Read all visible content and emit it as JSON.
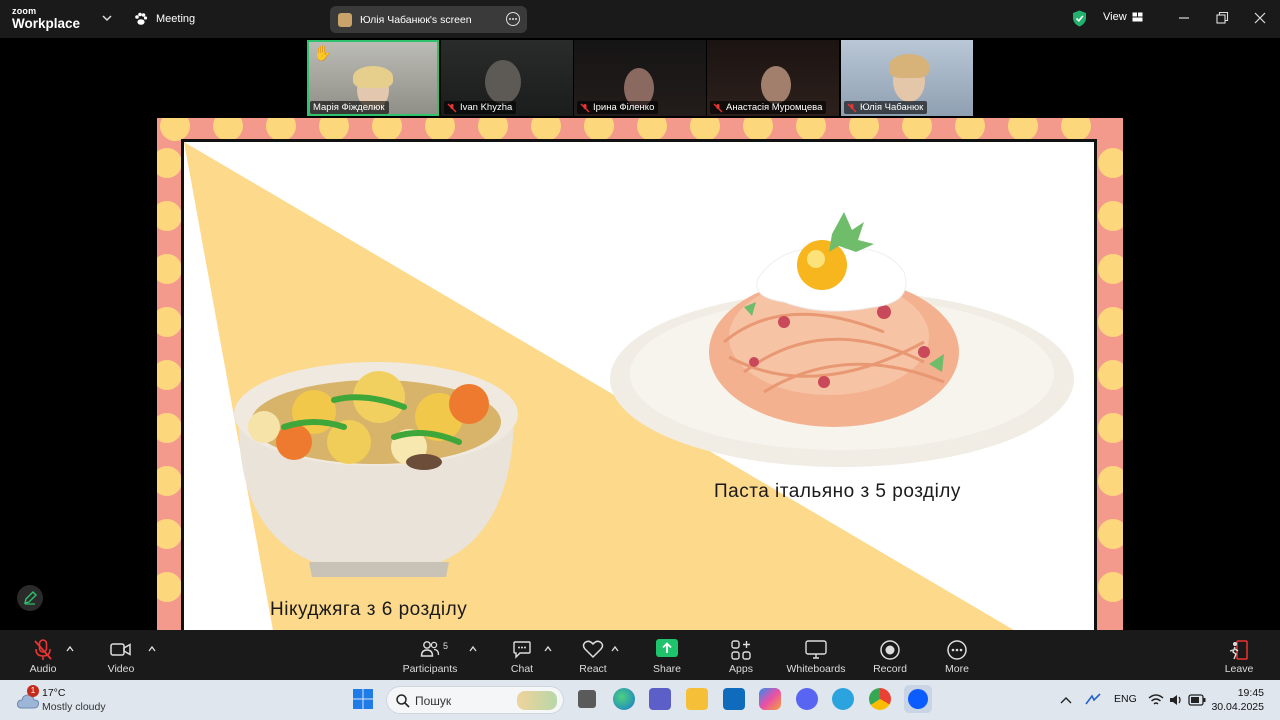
{
  "app": {
    "logo_line1": "zoom",
    "logo_line2": "Workplace",
    "meeting_label": "Meeting"
  },
  "share_indicator": {
    "label": "Юлія Чабанюк's screen"
  },
  "header": {
    "view_label": "View"
  },
  "participants": [
    {
      "name": "Марія Фіжделюк",
      "muted": false,
      "hand_raised": true,
      "active": true
    },
    {
      "name": "Ivan Khyzha",
      "muted": true
    },
    {
      "name": "Ірина Філенко",
      "muted": true
    },
    {
      "name": "Анастасія Муромцева",
      "muted": true
    },
    {
      "name": "Юлія Чабанюк",
      "muted": true
    }
  ],
  "slide": {
    "caption_pasta": "Паста італьяно з 5 розділу",
    "caption_nikujaga": "Нікуджяга з 6 розділу"
  },
  "toolbar": {
    "audio": "Audio",
    "video": "Video",
    "participants": "Participants",
    "participants_count": "5",
    "chat": "Chat",
    "react": "React",
    "share": "Share",
    "apps": "Apps",
    "whiteboards": "Whiteboards",
    "record": "Record",
    "more": "More",
    "leave": "Leave"
  },
  "taskbar": {
    "weather_temp": "17°C",
    "weather_desc": "Mostly cloudy",
    "weather_badge": "1",
    "search_placeholder": "Пошук",
    "language": "ENG",
    "time": "19:45",
    "date": "30.04.2025"
  },
  "colors": {
    "accent_green": "#2ec26c",
    "share_green": "#1fc36b",
    "slide_border": "#f49a8c",
    "dots": "#fdd77c"
  }
}
